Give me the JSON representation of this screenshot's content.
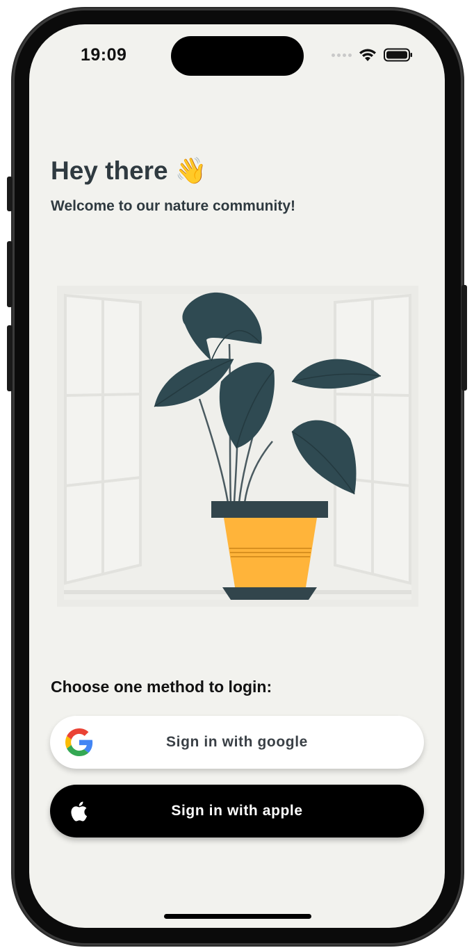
{
  "status_bar": {
    "time": "19:09",
    "icons": [
      "cellular-signal-icon",
      "wifi-icon",
      "battery-icon"
    ]
  },
  "header": {
    "title": "Hey there 👋",
    "subtitle": "Welcome to our nature community!"
  },
  "illustration": {
    "description_icon": "potted-plant-in-window-illustration",
    "colors": {
      "leaf": "#2f4a52",
      "pot": "#ffb43a",
      "pot_rim": "#32454c",
      "window": "#ebebe7"
    }
  },
  "login": {
    "prompt": "Choose one method to login:",
    "google_label": "Sign in with google",
    "apple_label": "Sign in with apple"
  },
  "colors": {
    "background": "#f2f2ee",
    "text_dark": "#2f3a40",
    "google_button": "#ffffff",
    "apple_button": "#000000"
  }
}
